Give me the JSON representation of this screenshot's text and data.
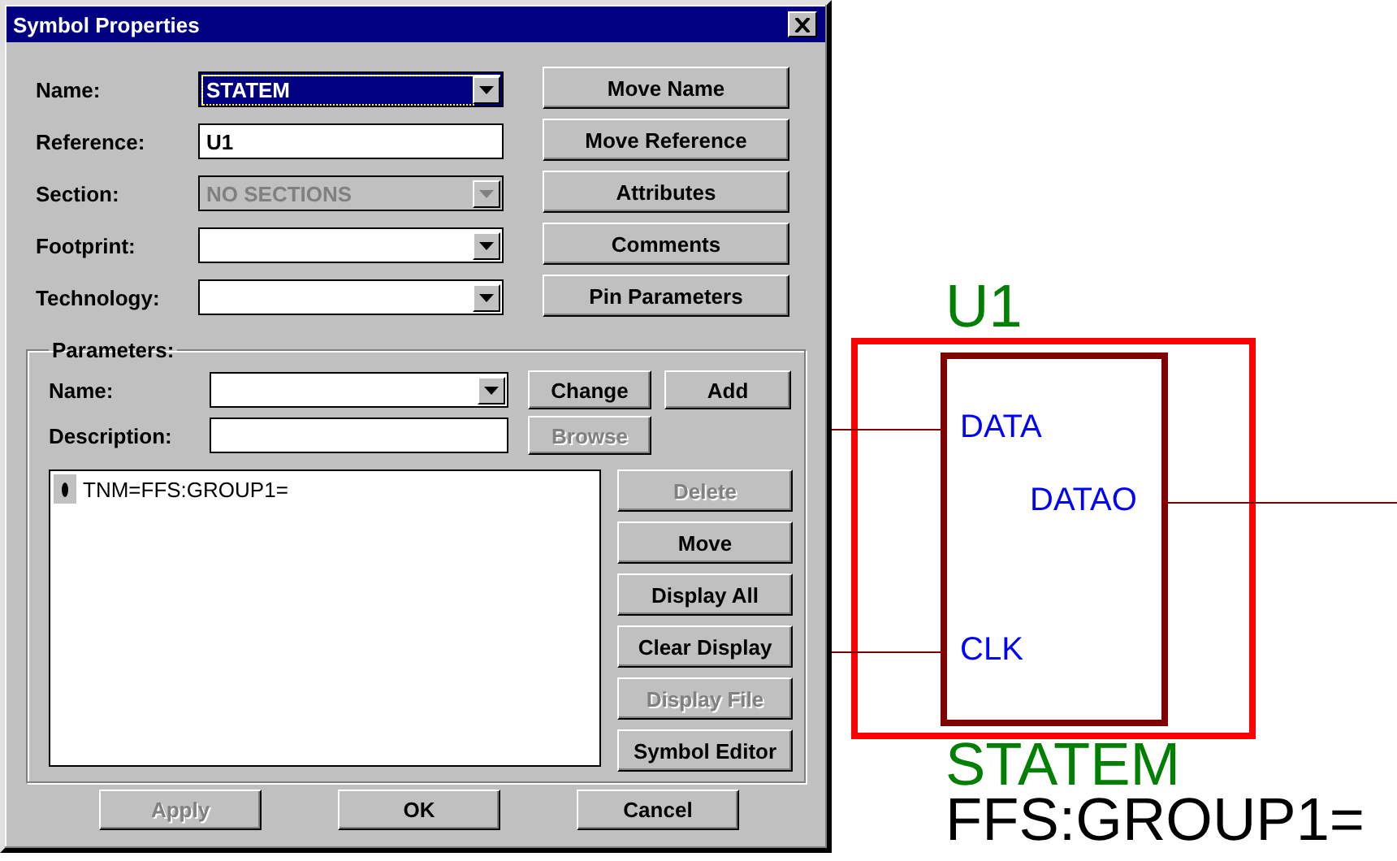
{
  "dialog": {
    "title": "Symbol Properties",
    "fields": [
      {
        "label": "Name:",
        "value": "STATEM",
        "kind": "combo",
        "highlighted": true,
        "disabled": false
      },
      {
        "label": "Reference:",
        "value": "U1",
        "kind": "text",
        "highlighted": false,
        "disabled": false
      },
      {
        "label": "Section:",
        "value": "NO SECTIONS",
        "kind": "combo",
        "highlighted": false,
        "disabled": true
      },
      {
        "label": "Footprint:",
        "kind": "combo",
        "highlighted": false,
        "disabled": false
      },
      {
        "label": "Technology:",
        "kind": "combo",
        "highlighted": false,
        "disabled": false
      }
    ],
    "side_buttons": [
      {
        "label": "Move Name",
        "disabled": false
      },
      {
        "label": "Move Reference",
        "disabled": false
      },
      {
        "label": "Attributes",
        "disabled": false
      },
      {
        "label": "Comments",
        "disabled": false
      },
      {
        "label": "Pin Parameters",
        "disabled": false
      }
    ],
    "parameters": {
      "title": "Parameters:",
      "name_label": "Name:",
      "description_label": "Description:",
      "change_button": {
        "label": "Change",
        "disabled": false
      },
      "add_button": {
        "label": "Add",
        "disabled": false
      },
      "browse_button": {
        "label": "Browse",
        "disabled": true
      },
      "list": [
        {
          "text": "TNM=FFS:GROUP1=",
          "selected": false
        }
      ],
      "list_buttons": [
        {
          "label": "Delete",
          "disabled": true
        },
        {
          "label": "Move",
          "disabled": false
        },
        {
          "label": "Display All",
          "disabled": false
        },
        {
          "label": "Clear Display",
          "disabled": false
        },
        {
          "label": "Display File",
          "disabled": true
        },
        {
          "label": "Symbol Editor",
          "disabled": false
        }
      ]
    },
    "footer_buttons": [
      {
        "label": "Apply",
        "disabled": true
      },
      {
        "label": "OK",
        "disabled": false
      },
      {
        "label": "Cancel",
        "disabled": false
      }
    ]
  },
  "schematic": {
    "reference": "U1",
    "part_name": "STATEM",
    "attribute": "FFS:GROUP1=",
    "left_pins": [
      {
        "name": "DATA"
      },
      {
        "name": "CLK"
      }
    ],
    "right_pins": [
      {
        "name": "DATAO"
      }
    ]
  }
}
